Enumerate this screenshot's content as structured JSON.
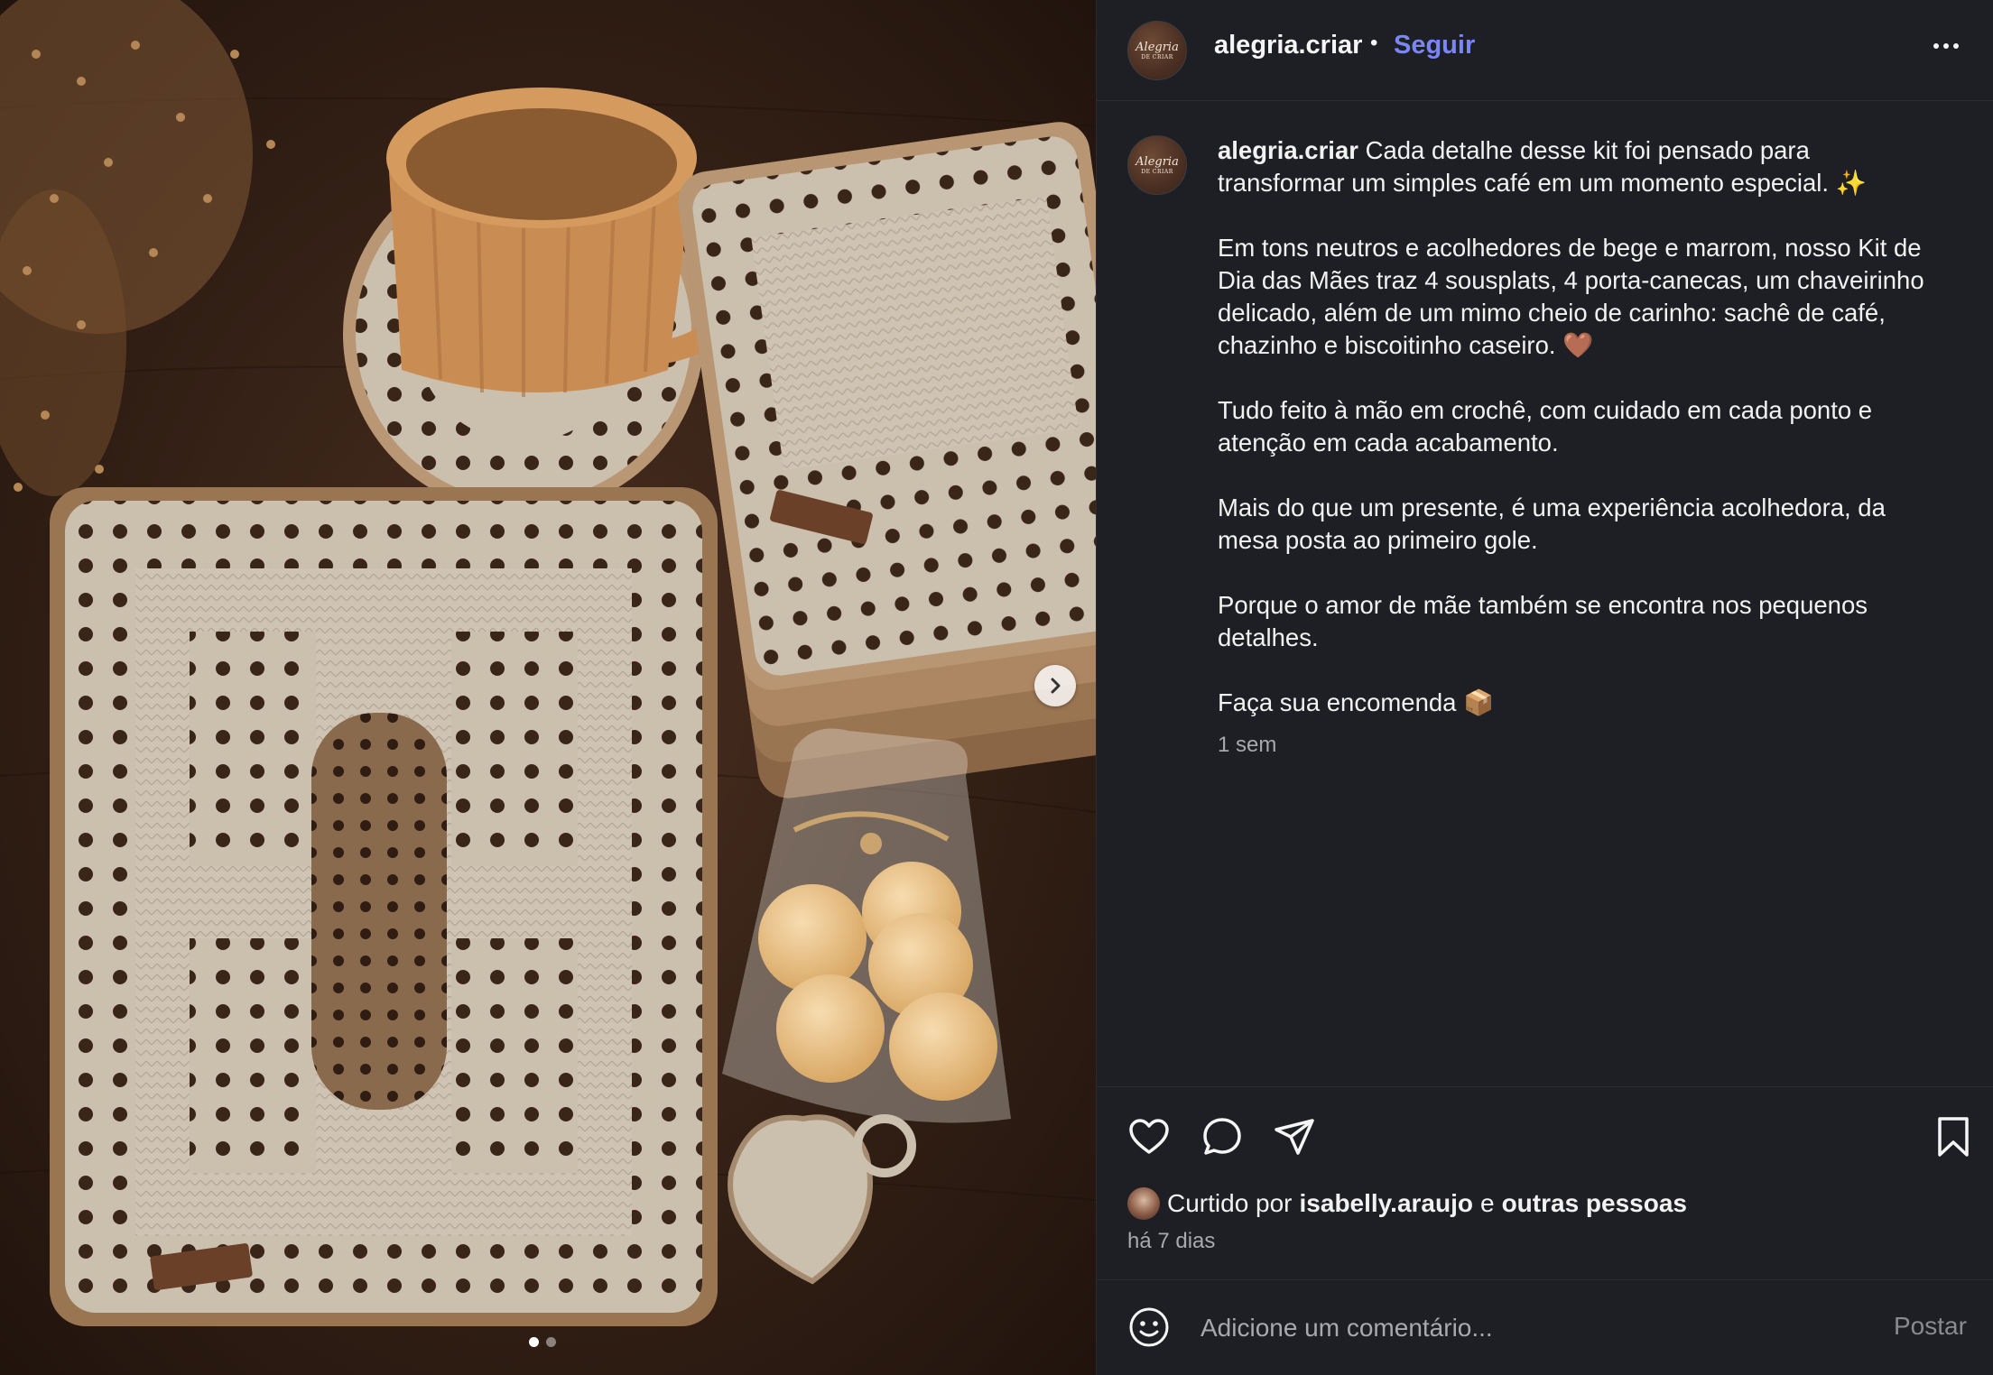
{
  "post": {
    "username": "alegria.criar",
    "separator": "•",
    "follow_label": "Seguir",
    "avatar_logo_main": "Alegria",
    "avatar_logo_sub": "DE CRIAR"
  },
  "caption": {
    "username": "alegria.criar",
    "paragraphs": [
      "Cada detalhe desse kit foi pensado para transformar um simples café em um momento especial. ✨",
      "Em tons neutros e acolhedores de bege e marrom, nosso Kit de Dia das Mães traz 4 sousplats, 4 porta-canecas, um chaveirinho delicado, além de um mimo cheio de carinho: sachê de café, chazinho e biscoitinho caseiro. 🤎",
      "Tudo feito à mão em crochê, com cuidado em cada ponto e atenção em cada acabamento.",
      "Mais do que um presente, é uma experiência acolhedora, da mesa posta ao primeiro gole.",
      "Porque o amor de mãe também se encontra nos pequenos detalhes.",
      "Faça sua encomenda 📦"
    ],
    "time": "1 sem"
  },
  "likes": {
    "prefix": "Curtido por",
    "user": "isabelly.araujo",
    "connector": "e",
    "others": "outras pessoas",
    "time": "há 7 dias"
  },
  "comment": {
    "placeholder": "Adicione um comentário...",
    "post_label": "Postar"
  },
  "carousel": {
    "total": 2,
    "current": 1
  },
  "colors": {
    "background": "#1e1f24",
    "accent_follow": "#7b86f5",
    "muted_text": "#a8a8ad",
    "border": "#2c2d33"
  },
  "icons": [
    "heart-icon",
    "comment-icon",
    "share-icon",
    "bookmark-icon",
    "emoji-icon",
    "more-icon",
    "chevron-right-icon"
  ]
}
